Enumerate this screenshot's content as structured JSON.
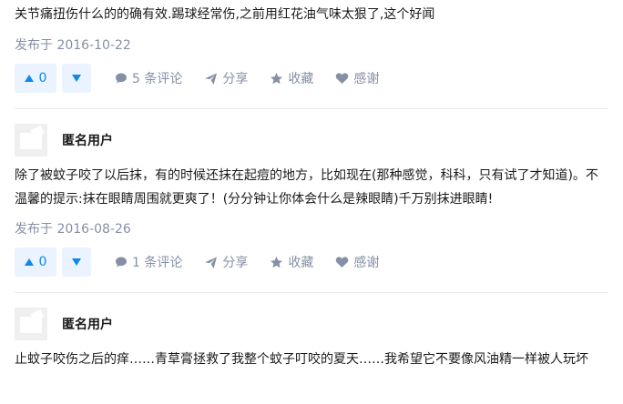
{
  "answers": [
    {
      "content": "关节痛扭伤什么的的确有效.踢球经常伤,之前用红花油气味太狠了,这个好闻",
      "date": "发布于 2016-10-22",
      "votes": "0",
      "comments": "5 条评论",
      "share": "分享",
      "favorite": "收藏",
      "thanks": "感谢"
    },
    {
      "author": "匿名用户",
      "content": "除了被蚊子咬了以后抹，有的时候还抹在起痘的地方，比如现在(那种感觉，科科，只有试了才知道)。不温馨的提示:抹在眼睛周围就更爽了！(分分钟让你体会什么是辣眼睛)千万别抹进眼睛!",
      "date": "发布于 2016-08-26",
      "votes": "0",
      "comments": "1 条评论",
      "share": "分享",
      "favorite": "收藏",
      "thanks": "感谢"
    },
    {
      "author": "匿名用户",
      "content": "止蚊子咬伤之后的痒……青草膏拯救了我整个蚊子叮咬的夏天……我希望它不要像风油精一样被人玩坏"
    }
  ],
  "colors": {
    "accent": "#0f88eb",
    "vote_bg": "#eaf3ff",
    "meta": "#8590a6",
    "divider": "#ebebeb"
  },
  "icons": [
    "triangle-up-icon",
    "triangle-down-icon",
    "comment-icon",
    "share-icon",
    "star-icon",
    "heart-icon"
  ]
}
